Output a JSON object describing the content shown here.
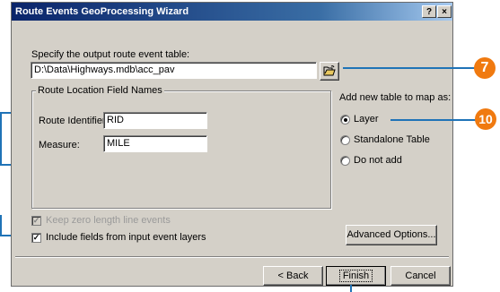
{
  "window": {
    "title": "Route Events GeoProcessing Wizard",
    "help_label": "?",
    "close_label": "×"
  },
  "output": {
    "label": "Specify the output route event table:",
    "value": "D:\\Data\\Highways.mdb\\acc_pav",
    "browse_icon": "open-folder-icon"
  },
  "fields_group": {
    "title": "Route Location Field Names",
    "route_label": "Route Identifier:",
    "route_value": "RID",
    "measure_label": "Measure:",
    "measure_value": "MILE"
  },
  "add_table": {
    "label": "Add new table to map as:",
    "options": [
      {
        "label": "Layer",
        "selected": true
      },
      {
        "label": "Standalone Table",
        "selected": false
      },
      {
        "label": "Do not add",
        "selected": false
      }
    ]
  },
  "checks": {
    "zero_length_label": "Keep zero length line events",
    "zero_length_checked": true,
    "zero_length_enabled": false,
    "include_fields_label": "Include fields from input event layers",
    "include_fields_checked": true
  },
  "buttons": {
    "advanced": "Advanced Options...",
    "back": "< Back",
    "finish": "Finish",
    "cancel": "Cancel"
  },
  "callouts": {
    "browse": "7",
    "layer": "10"
  },
  "colors": {
    "title_bar": "#0a246a",
    "callout": "#f07a10",
    "leader_line": "#1f73b7"
  }
}
